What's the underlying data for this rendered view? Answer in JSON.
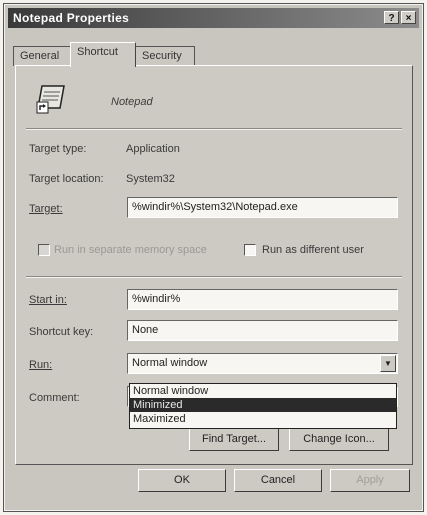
{
  "window": {
    "title": "Notepad Properties",
    "help_glyph": "?",
    "close_glyph": "×"
  },
  "tabs": [
    {
      "label": "General"
    },
    {
      "label": "Shortcut"
    },
    {
      "label": "Security"
    }
  ],
  "shortcut": {
    "app_name": "Notepad",
    "target_type_label": "Target type:",
    "target_type_value": "Application",
    "target_location_label": "Target location:",
    "target_location_value": "System32",
    "target_label": "Target:",
    "target_value": "%windir%\\System32\\Notepad.exe",
    "separate_memory_label": "Run in separate memory space",
    "run_as_label": "Run as different user",
    "start_in_label": "Start in:",
    "start_in_value": "%windir%",
    "shortcut_key_label": "Shortcut key:",
    "shortcut_key_value": "None",
    "run_label": "Run:",
    "run_value": "Normal window",
    "run_options": [
      "Normal window",
      "Minimized",
      "Maximized"
    ],
    "run_selected_option": "Minimized",
    "comment_label": "Comment:",
    "find_target_label": "Find Target...",
    "change_icon_label": "Change Icon..."
  },
  "footer": {
    "ok_label": "OK",
    "cancel_label": "Cancel",
    "apply_label": "Apply"
  }
}
